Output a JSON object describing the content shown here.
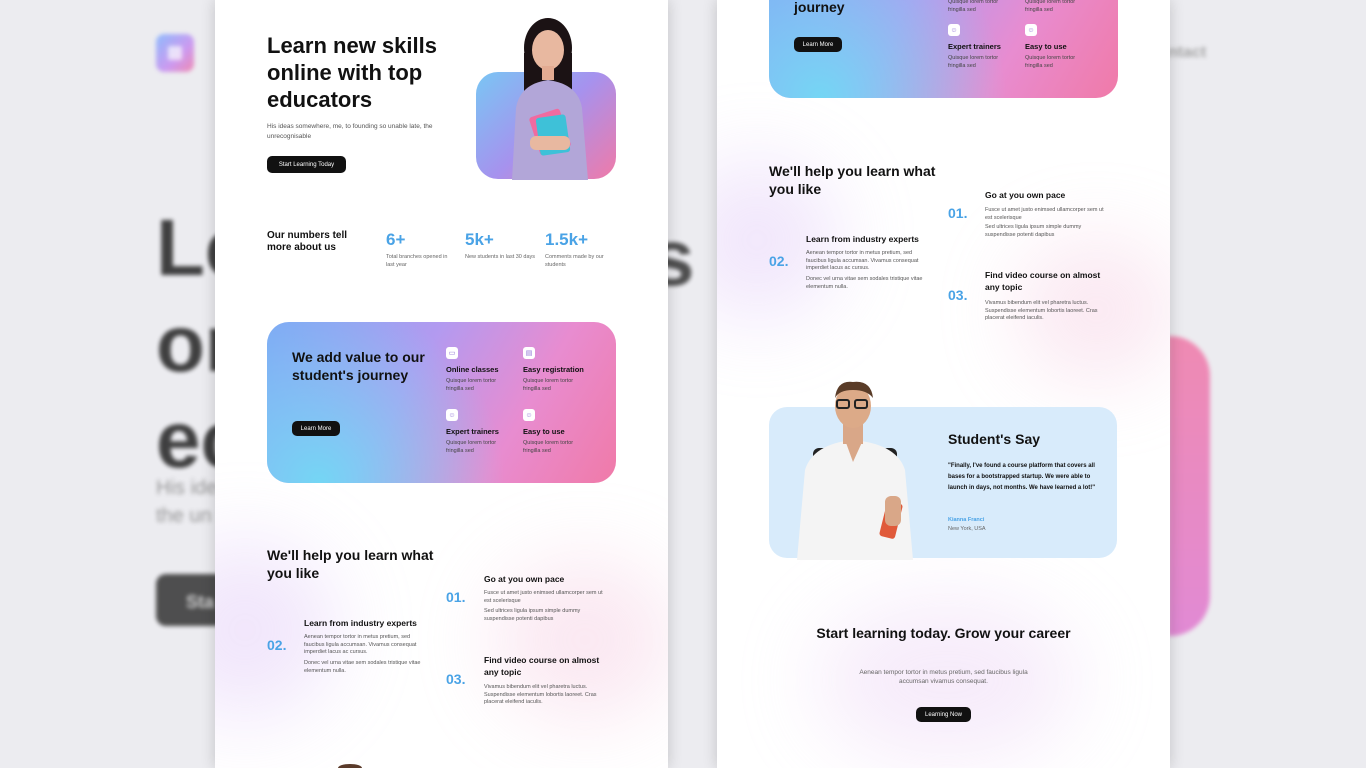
{
  "background": {
    "nav_contact": "ntact",
    "headline_fragment": [
      "Le",
      "on",
      "ec"
    ],
    "headline_right_fragment": "s",
    "sub_fragment": [
      "His ide",
      "the un"
    ],
    "button_fragment": "Sta"
  },
  "hero": {
    "title": "Learn new skills online with top educators",
    "subtitle": "His ideas somewhere, me, to founding so unable late, the unrecognisable",
    "cta": "Start Learning Today"
  },
  "numbers": {
    "title": "Our numbers tell more about us",
    "stats": [
      {
        "value": "6+",
        "label": "Total branches opened in last year"
      },
      {
        "value": "5k+",
        "label": "New students in last 30 days"
      },
      {
        "value": "1.5k+",
        "label": "Comments made by our students"
      }
    ]
  },
  "value": {
    "title": "We add value to our student's journey",
    "title_tail": "journey",
    "cta": "Learn More",
    "features": [
      {
        "icon": "monitor-icon",
        "title": "Online classes",
        "desc": "Quisque lorem tortor fringilla sed"
      },
      {
        "icon": "clipboard-icon",
        "title": "Easy registration",
        "desc": "Quisque lorem tortor fringilla sed"
      },
      {
        "icon": "users-icon",
        "title": "Expert trainers",
        "desc": "Quisque lorem tortor fringilla sed"
      },
      {
        "icon": "smile-icon",
        "title": "Easy to use",
        "desc": "Quisque lorem tortor fringilla sed"
      }
    ]
  },
  "help": {
    "title": "We'll help you learn what you like",
    "steps": [
      {
        "num": "01.",
        "title": "Go at you own pace",
        "desc": "Fusce ut amet justo enimsed ullamcorper sem ut est scelerisque",
        "desc2": "Sed ultrices ligula ipsum simple dummy suspendisse potenti dapibus"
      },
      {
        "num": "02.",
        "title": "Learn from industry experts",
        "desc": "Aenean tempor tortor in metus pretium, sed faucibus ligula accumsan. Vivamus consequat imperdiet lacus ac cursus.",
        "desc2": "Donec vel urna vitae sem sodales tristique vitae elementum nulla."
      },
      {
        "num": "03.",
        "title": "Find video course on almost any topic",
        "desc": "Vivamus bibendum elit vel pharetra luctus. Suspendisse elementum lobortis laoreet. Cras placerat eleifend iaculis."
      }
    ]
  },
  "testimonial": {
    "title": "Student's Say",
    "quote": "\"Finally, I've found a course platform that covers all bases for a bootstrapped startup. We were able to launch in days, not months. We have learned a lot!\"",
    "name": "Kianna Franci",
    "location": "New York, USA"
  },
  "cta_section": {
    "title": "Start learning today. Grow your career",
    "subtitle": "Aenean tempor tortor in metus pretium, sed faucibus ligula accumsan vivamus consequat.",
    "button": "Learning Now"
  },
  "colors": {
    "accent_blue": "#4aa3e6",
    "dark": "#111111",
    "card_pink": "#f07aa8",
    "card_purple": "#b39af0",
    "card_cyan": "#79c6f4",
    "testimonial_bg": "#d8ebfb"
  }
}
